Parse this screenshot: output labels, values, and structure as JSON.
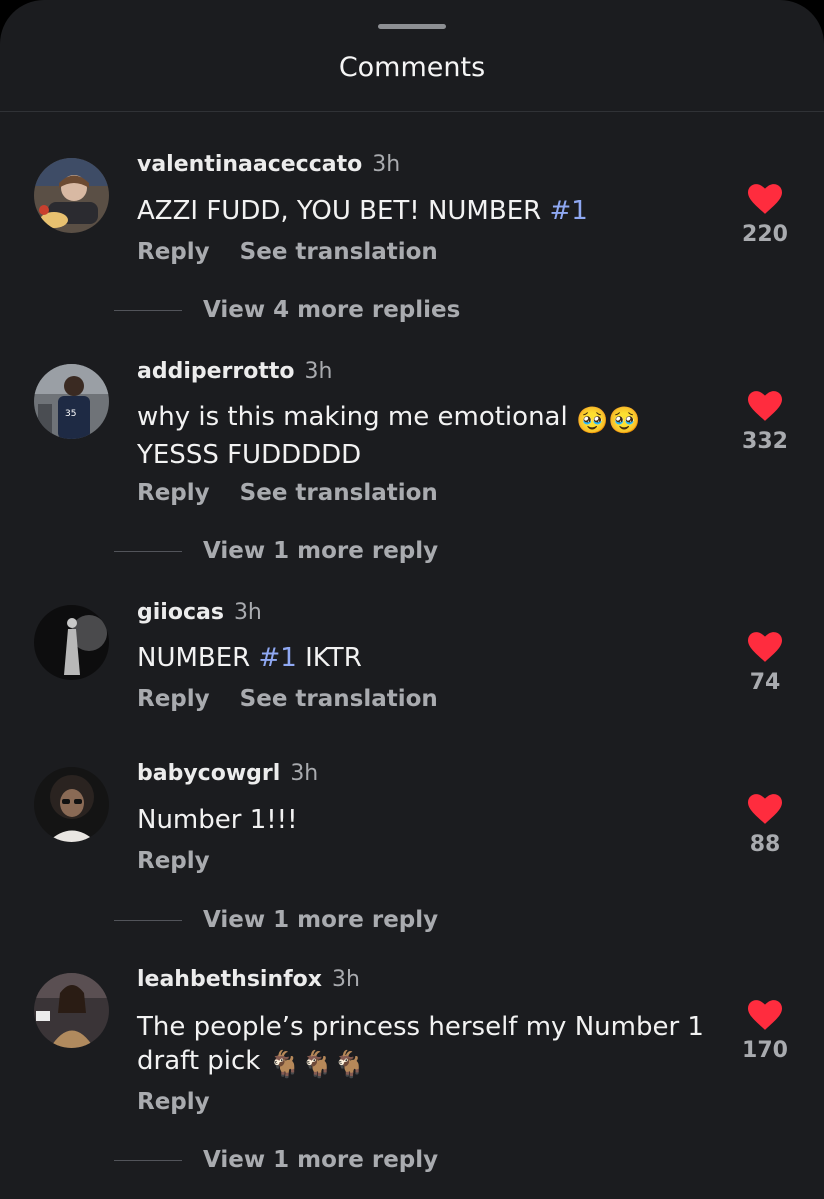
{
  "sheet": {
    "title": "Comments"
  },
  "colors": {
    "background": "#1b1c1f",
    "like": "#ff2c3e",
    "hashtag": "#8fa8f2",
    "muted": "#a9abaf"
  },
  "comments": [
    {
      "username": "valentinaaceccato",
      "time": "3h",
      "text_main": "AZZI FUDD, YOU BET! NUMBER ",
      "hashtag": "#1",
      "text_tail": "",
      "reply_label": "Reply",
      "translate_label": "See translation",
      "likes": "220",
      "view_replies": "View 4 more replies"
    },
    {
      "username": "addiperrotto",
      "time": "3h",
      "text_main": "why is this making me emotional ",
      "emojis": "🥹🥹",
      "text_line2": "YESSS FUDDDDD",
      "reply_label": "Reply",
      "translate_label": "See translation",
      "likes": "332",
      "view_replies": "View 1 more reply"
    },
    {
      "username": "giiocas",
      "time": "3h",
      "text_main": "NUMBER ",
      "hashtag": "#1",
      "text_tail": " IKTR",
      "reply_label": "Reply",
      "translate_label": "See translation",
      "likes": "74"
    },
    {
      "username": "babycowgrl",
      "time": "3h",
      "text_main": "Number 1!!!",
      "reply_label": "Reply",
      "likes": "88",
      "view_replies": "View 1 more reply"
    },
    {
      "username": "leahbethsinfox",
      "time": "3h",
      "text_main": "The people’s princess herself my Number 1 draft pick ",
      "emojis": "🐐🐐🐐",
      "reply_label": "Reply",
      "likes": "170",
      "view_replies": "View 1 more reply"
    }
  ]
}
